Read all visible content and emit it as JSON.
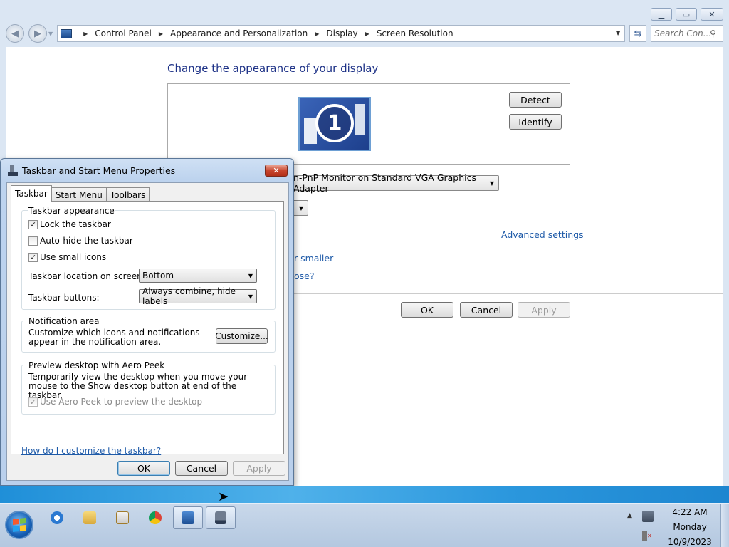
{
  "control_panel": {
    "breadcrumb": [
      "Control Panel",
      "Appearance and Personalization",
      "Display",
      "Screen Resolution"
    ],
    "search_placeholder": "Search Con...",
    "title": "Change the appearance of your display",
    "monitor_number": "1",
    "detect_label": "Detect",
    "identify_label": "Identify",
    "display_value": "n-PnP Monitor on Standard VGA Graphics Adapter",
    "advanced_link": "Advanced settings",
    "text_size_link": "r smaller",
    "which_link": "ose?",
    "ok_label": "OK",
    "cancel_label": "Cancel",
    "apply_label": "Apply"
  },
  "dialog": {
    "title": "Taskbar and Start Menu Properties",
    "tabs": [
      "Taskbar",
      "Start Menu",
      "Toolbars"
    ],
    "appearance": {
      "group_label": "Taskbar appearance",
      "lock": {
        "label": "Lock the taskbar",
        "checked": true
      },
      "autohide": {
        "label": "Auto-hide the taskbar",
        "checked": false
      },
      "small_icons": {
        "label": "Use small icons",
        "checked": true
      },
      "location_label": "Taskbar location on screen:",
      "location_value": "Bottom",
      "buttons_label": "Taskbar buttons:",
      "buttons_value": "Always combine, hide labels"
    },
    "notification": {
      "group_label": "Notification area",
      "desc": "Customize which icons and notifications appear in the notification area.",
      "customize_label": "Customize..."
    },
    "aero": {
      "group_label": "Preview desktop with Aero Peek",
      "desc": "Temporarily view the desktop when you move your mouse to the Show desktop button at end of the taskbar.",
      "checkbox_label": "Use Aero Peek to preview the desktop",
      "checked": true,
      "disabled": true
    },
    "help_link": "How do I customize the taskbar?",
    "ok_label": "OK",
    "cancel_label": "Cancel",
    "apply_label": "Apply"
  },
  "taskbar": {
    "icons": [
      "internet-explorer-icon",
      "folder-icon",
      "media-player-icon",
      "chrome-icon",
      "control-panel-icon",
      "taskbar-properties-icon"
    ],
    "time": "4:22 AM",
    "day": "Monday",
    "date": "10/9/2023"
  }
}
